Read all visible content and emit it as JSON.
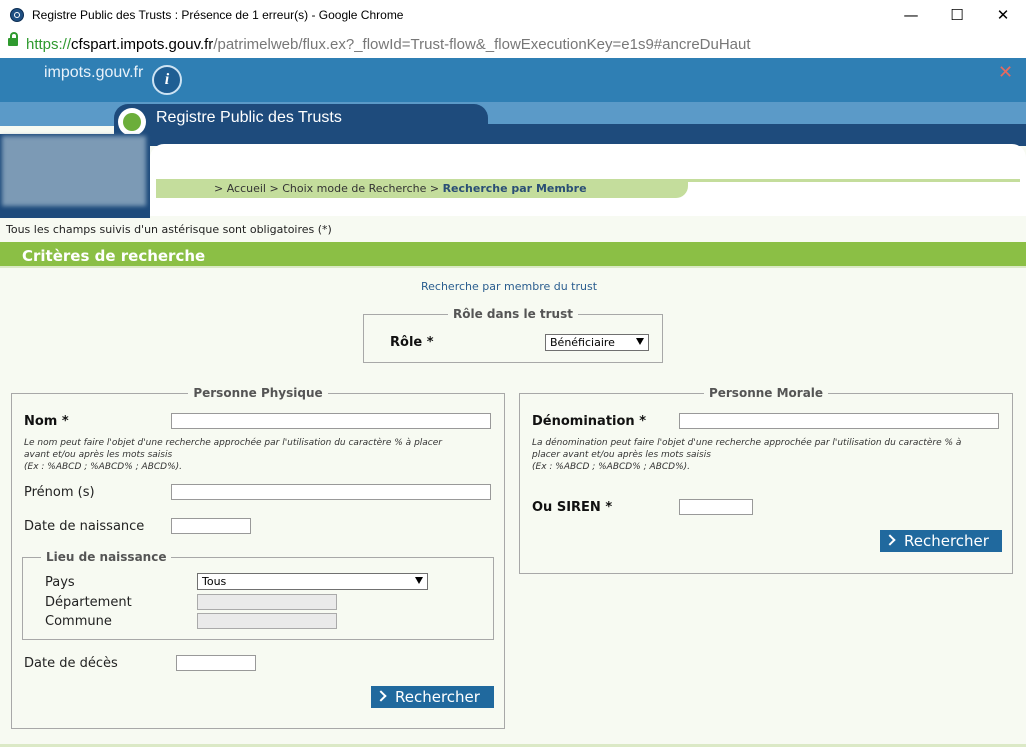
{
  "window": {
    "title": "Registre Public des Trusts : Présence de 1 erreur(s) - Google Chrome",
    "minimize_glyph": "—",
    "maximize_glyph": "☐",
    "close_glyph": "✕"
  },
  "address": {
    "scheme": "https://",
    "host": "cfspart.impots.gouv.fr",
    "path": "/patrimelweb/flux.ex?_flowId=Trust-flow&_flowExecutionKey=e1s9#ancreDuHaut"
  },
  "header": {
    "site_logo": "impots.gouv.fr",
    "info_glyph": "i",
    "close_glyph": "✕",
    "app_title": "Registre Public des Trusts"
  },
  "breadcrumb": {
    "path": "> Accueil > Choix mode de Recherche > ",
    "current": "Recherche par Membre"
  },
  "required_note": "Tous les champs suivis d'un astérisque sont obligatoires (*)",
  "section_title": "Critères de recherche",
  "subtitle": "Recherche par membre du trust",
  "role_box": {
    "legend": "Rôle dans le trust",
    "label": "Rôle *",
    "selected": "Bénéficiaire"
  },
  "personne_physique": {
    "legend": "Personne Physique",
    "nom_label": "Nom *",
    "nom_value": "",
    "nom_hint_1": "Le nom peut faire l'objet d'une recherche approchée par l'utilisation du caractère % à placer",
    "nom_hint_2": "avant et/ou après les mots saisis",
    "nom_hint_3": "(Ex : %ABCD ; %ABCD% ; ABCD%).",
    "prenom_label": "Prénom (s)",
    "prenom_value": "",
    "naissance_label": "Date de naissance",
    "naissance_value": "",
    "lieu_legend": "Lieu de naissance",
    "pays_label": "Pays",
    "pays_selected": "Tous",
    "departement_label": "Département",
    "commune_label": "Commune",
    "deces_label": "Date de décès",
    "deces_value": "",
    "search_button": "Rechercher"
  },
  "personne_morale": {
    "legend": "Personne Morale",
    "denomination_label": "Dénomination *",
    "denomination_value": "",
    "hint_1": "La dénomination peut faire l'objet d'une recherche approchée par l'utilisation du caractère % à",
    "hint_2": "placer avant et/ou après les mots saisis",
    "hint_3": "(Ex : %ABCD ; %ABCD% ; ABCD%).",
    "siren_label": "Ou SIREN *",
    "siren_value": "",
    "search_button": "Rechercher"
  },
  "colors": {
    "accent_green": "#8bbf45",
    "header_blue": "#2f7fb4",
    "navy": "#1e4b7c",
    "button_blue": "#20699e"
  }
}
